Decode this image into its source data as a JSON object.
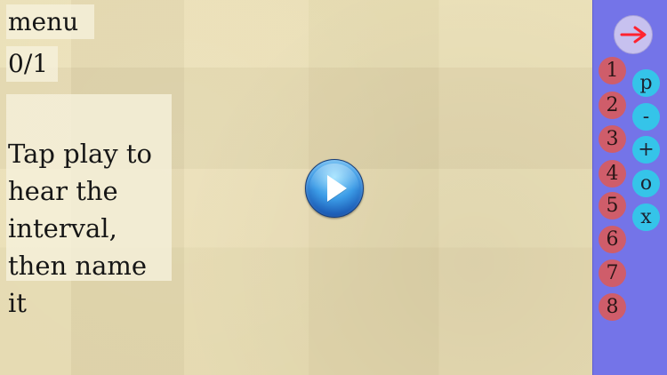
{
  "colors": {
    "panel": "#7474e8",
    "number_button": "#cf5d6a",
    "operator_button": "#35c4e9",
    "next_button": "#c7c1ef",
    "arrow": "#ff2330"
  },
  "header": {
    "menu_label": "menu",
    "score": "0/1"
  },
  "main": {
    "instruction": "Tap play to\nhear the\ninterval,\nthen name\nit",
    "play_icon": "play-icon"
  },
  "sidebar": {
    "next_icon": "arrow-right-icon",
    "numbers": [
      "1",
      "2",
      "3",
      "4",
      "5",
      "6",
      "7",
      "8"
    ],
    "operators": [
      "p",
      "-",
      "+",
      "o",
      "x"
    ]
  }
}
